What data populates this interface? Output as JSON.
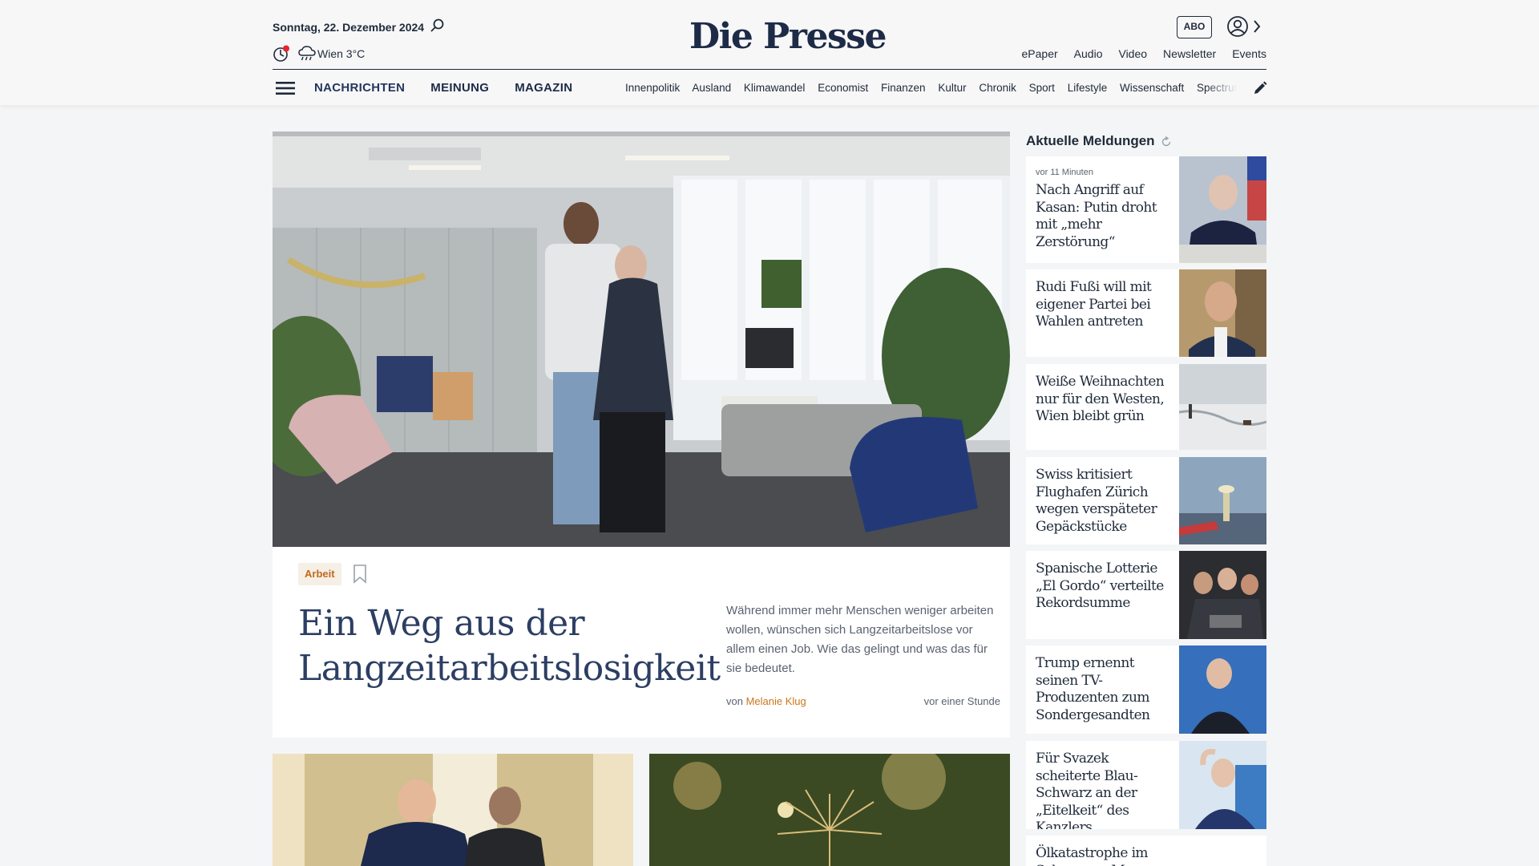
{
  "header": {
    "date": "Sonntag, 22. Dezember 2024",
    "weather": "Wien 3°C",
    "logo": "Die Presse",
    "abo_label": "ABO",
    "top_links": [
      "ePaper",
      "Audio",
      "Video",
      "Newsletter",
      "Events"
    ],
    "main_nav": [
      "NACHRICHTEN",
      "MEINUNG",
      "MAGAZIN"
    ],
    "sub_nav": [
      "Innenpolitik",
      "Ausland",
      "Klimawandel",
      "Economist",
      "Finanzen",
      "Kultur",
      "Chronik",
      "Sport",
      "Lifestyle",
      "Wissenschaft",
      "Spectrum"
    ],
    "icons": [
      "search-icon",
      "moon-icon",
      "weather-icon",
      "user-icon",
      "chevron-right-icon",
      "menu-icon",
      "edit-icon"
    ]
  },
  "hero": {
    "category": "Arbeit",
    "headline": "Ein Weg aus der Langzeitarbeitslosigkeit",
    "teaser": "Während immer mehr Menschen weniger arbeiten wollen, wünschen sich Langzeitarbeitslose vor allem einen Job. Wie das gelingt und was das für sie bedeutet.",
    "byline_prefix": "von",
    "author": "Melanie Klug",
    "time": "vor einer Stunde"
  },
  "sidebar": {
    "title": "Aktuelle Meldungen",
    "items": [
      {
        "meta": "vor 11 Minuten",
        "title": "Nach Angriff auf Kasan: Putin droht mit „mehr Zerstörung“"
      },
      {
        "meta": "",
        "title": "Rudi Fußi will mit eigener Partei bei Wahlen antreten"
      },
      {
        "meta": "",
        "title": "Weiße Weihnachten nur für den Westen, Wien bleibt grün"
      },
      {
        "meta": "",
        "title": "Swiss kritisiert Flughafen Zürich wegen verspäteter Gepäckstücke"
      },
      {
        "meta": "",
        "title": "Spanische Lotterie „El Gordo“ verteilte Rekordsumme"
      },
      {
        "meta": "",
        "title": "Trump ernennt seinen TV-Produzenten zum Sondergesandten"
      },
      {
        "meta": "",
        "title": "Für Svazek scheiterte Blau-Schwarz an der „Eitelkeit“ des Kanzlers"
      },
      {
        "meta": "",
        "title": "Ölkatastrophe im Schwarzen Meer"
      }
    ]
  },
  "colors": {
    "navy": "#1d2b47",
    "headline": "#2c3e63",
    "accent": "#c9771c",
    "badge_bg": "#f6efe6",
    "page_bg": "#f4f5f6"
  }
}
